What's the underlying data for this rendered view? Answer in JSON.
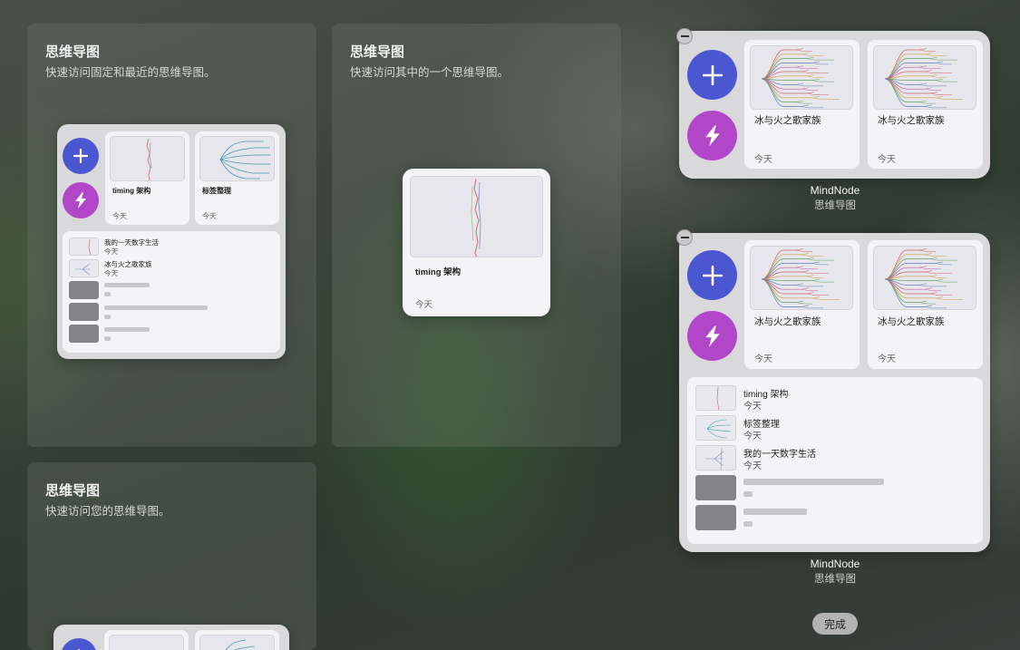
{
  "gallery": {
    "panel1": {
      "title": "思维导图",
      "subtitle": "快速访问固定和最近的思维导图。"
    },
    "panel2": {
      "title": "思维导图",
      "subtitle": "快速访问其中的一个思维导图。"
    },
    "panel3": {
      "title": "思维导图",
      "subtitle": "快速访问您的思维导图。"
    }
  },
  "widget_medium_preview": {
    "cards": [
      {
        "title": "timing 架构",
        "date": "今天"
      },
      {
        "title": "标签整理",
        "date": "今天"
      }
    ],
    "list": [
      {
        "title": "我的一天数字生活",
        "date": "今天"
      },
      {
        "title": "冰与火之歌家族",
        "date": "今天"
      }
    ]
  },
  "widget_small_preview": {
    "title": "timing 架构",
    "date": "今天"
  },
  "placed_widget_1": {
    "cards": [
      {
        "title": "冰与火之歌家族",
        "date": "今天"
      },
      {
        "title": "冰与火之歌家族",
        "date": "今天"
      }
    ],
    "caption_name": "MindNode",
    "caption_sub": "思维导图"
  },
  "placed_widget_2": {
    "cards": [
      {
        "title": "冰与火之歌家族",
        "date": "今天"
      },
      {
        "title": "冰与火之歌家族",
        "date": "今天"
      }
    ],
    "list": [
      {
        "title": "timing 架构",
        "date": "今天"
      },
      {
        "title": "标签整理",
        "date": "今天"
      },
      {
        "title": "我的一天数字生活",
        "date": "今天"
      }
    ],
    "caption_name": "MindNode",
    "caption_sub": "思维导图"
  },
  "done_label": "完成",
  "icons": {
    "add": "plus-icon",
    "quick": "lightning-icon",
    "remove": "minus-icon"
  },
  "colors": {
    "add_button": "#4b57d0",
    "quick_button": "#b147c8"
  }
}
